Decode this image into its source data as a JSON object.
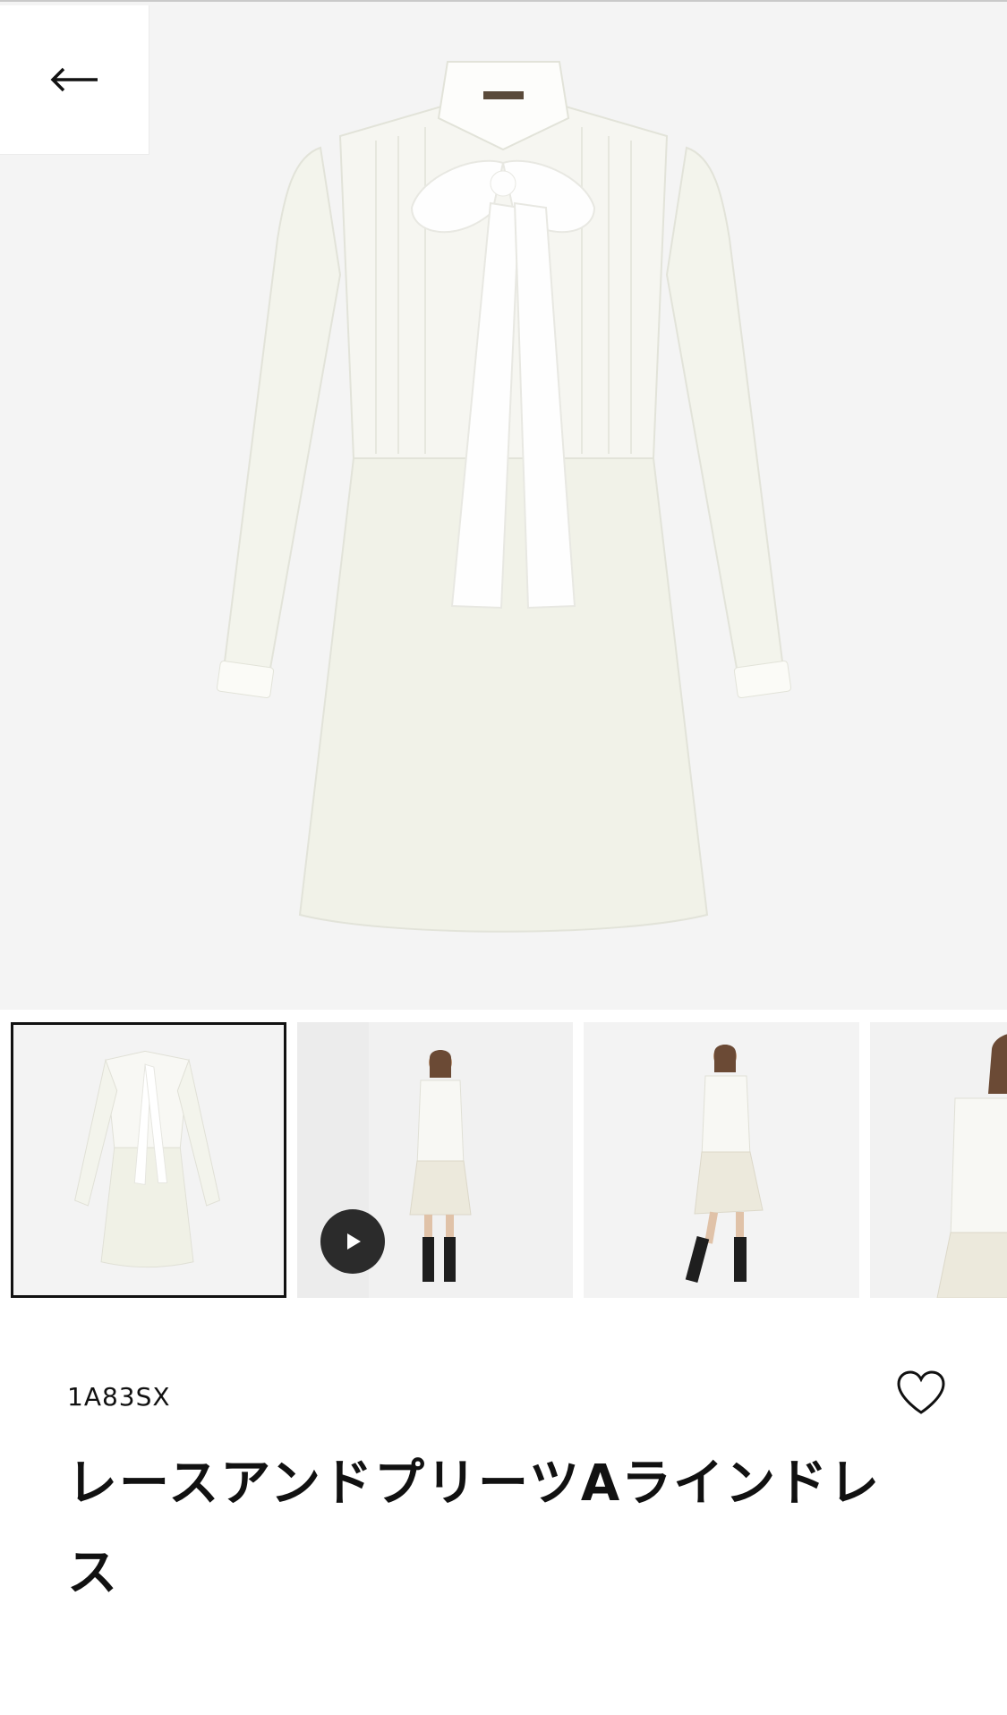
{
  "header": {
    "back_icon": "arrow-left-icon"
  },
  "gallery": {
    "main_image": "dress-product-image",
    "thumbnails": [
      {
        "label": "dress-flat",
        "selected": true
      },
      {
        "label": "model-front-video",
        "selected": false,
        "video": true
      },
      {
        "label": "model-walking",
        "selected": false
      },
      {
        "label": "model-closeup",
        "selected": false
      }
    ]
  },
  "product": {
    "sku": "1A83SX",
    "title": "レースアンドプリーツAラインドレス",
    "wishlist_icon": "heart-icon"
  },
  "colors": {
    "background": "#f4f4f4",
    "text": "#111111"
  }
}
